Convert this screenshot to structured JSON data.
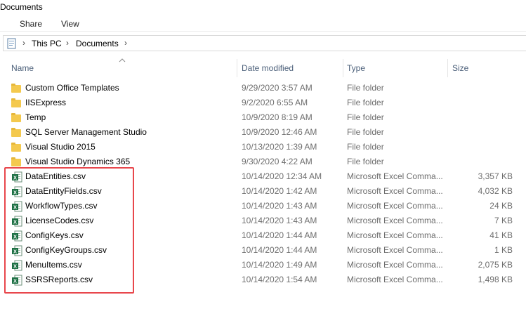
{
  "window": {
    "title": "Documents"
  },
  "ribbon": {
    "tabs": [
      "Share",
      "View"
    ]
  },
  "address": {
    "crumbs": [
      "This PC",
      "Documents"
    ]
  },
  "columns": {
    "name": "Name",
    "date": "Date modified",
    "type": "Type",
    "size": "Size"
  },
  "files": [
    {
      "name": "Custom Office Templates",
      "date": "9/29/2020 3:57 AM",
      "type": "File folder",
      "size": "",
      "icon": "folder-icon"
    },
    {
      "name": "IISExpress",
      "date": "9/2/2020 6:55 AM",
      "type": "File folder",
      "size": "",
      "icon": "folder-icon"
    },
    {
      "name": "Temp",
      "date": "10/9/2020 8:19 AM",
      "type": "File folder",
      "size": "",
      "icon": "folder-icon"
    },
    {
      "name": "SQL Server Management Studio",
      "date": "10/9/2020 12:46 AM",
      "type": "File folder",
      "size": "",
      "icon": "folder-icon"
    },
    {
      "name": "Visual Studio 2015",
      "date": "10/13/2020 1:39 AM",
      "type": "File folder",
      "size": "",
      "icon": "folder-icon"
    },
    {
      "name": "Visual Studio Dynamics 365",
      "date": "9/30/2020 4:22 AM",
      "type": "File folder",
      "size": "",
      "icon": "folder-icon"
    },
    {
      "name": "DataEntities.csv",
      "date": "10/14/2020 12:34 AM",
      "type": "Microsoft Excel Comma...",
      "size": "3,357 KB",
      "icon": "excel-csv-icon"
    },
    {
      "name": "DataEntityFields.csv",
      "date": "10/14/2020 1:42 AM",
      "type": "Microsoft Excel Comma...",
      "size": "4,032 KB",
      "icon": "excel-csv-icon"
    },
    {
      "name": "WorkflowTypes.csv",
      "date": "10/14/2020 1:43 AM",
      "type": "Microsoft Excel Comma...",
      "size": "24 KB",
      "icon": "excel-csv-icon"
    },
    {
      "name": "LicenseCodes.csv",
      "date": "10/14/2020 1:43 AM",
      "type": "Microsoft Excel Comma...",
      "size": "7 KB",
      "icon": "excel-csv-icon"
    },
    {
      "name": "ConfigKeys.csv",
      "date": "10/14/2020 1:44 AM",
      "type": "Microsoft Excel Comma...",
      "size": "41 KB",
      "icon": "excel-csv-icon"
    },
    {
      "name": "ConfigKeyGroups.csv",
      "date": "10/14/2020 1:44 AM",
      "type": "Microsoft Excel Comma...",
      "size": "1 KB",
      "icon": "excel-csv-icon"
    },
    {
      "name": "MenuItems.csv",
      "date": "10/14/2020 1:49 AM",
      "type": "Microsoft Excel Comma...",
      "size": "2,075 KB",
      "icon": "excel-csv-icon"
    },
    {
      "name": "SSRSReports.csv",
      "date": "10/14/2020 1:54 AM",
      "type": "Microsoft Excel Comma...",
      "size": "1,498 KB",
      "icon": "excel-csv-icon"
    }
  ],
  "colors": {
    "highlight": "#e8474c",
    "folder": "#f4c94e",
    "excel": "#1d7044",
    "header_text": "#4c607a"
  }
}
